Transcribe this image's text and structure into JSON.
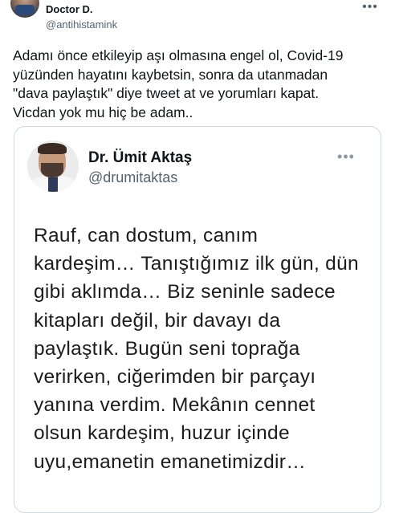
{
  "tweet": {
    "author": {
      "name": "Doctor D.",
      "handle": "@antihistamink"
    },
    "more_icon": "more-horizontal-icon",
    "text_lines": [
      "Adamı önce etkileyip aşı olmasına engel ol, Covid-19",
      "yüzünden hayatını kaybetsin, sonra da utanmadan",
      "\"dava paylaştık\" diye tweet at ve yorumları kapat.",
      "Vicdan yok mu hiç be adam.."
    ]
  },
  "quoted_tweet": {
    "author": {
      "name": "Dr. Ümit Aktaş",
      "handle": "@drumitaktas"
    },
    "more_icon": "more-horizontal-icon",
    "text_lines": [
      "Rauf, can dostum, canım",
      "kardeşim… Tanıştığımız ilk gün, dün",
      "gibi aklımda… Biz seninle sadece",
      "kitapları değil, bir davayı da",
      "paylaştık. Bugün seni toprağa",
      "verirken, ciğerimden bir parçayı",
      "yanına verdim. Mekânın cennet",
      "olsun kardeşim, huzur içinde",
      "uyu,emanetin emanetimizdir…"
    ]
  },
  "colors": {
    "text": "#0f1419",
    "secondary": "#536471",
    "border": "#cfd9de"
  }
}
